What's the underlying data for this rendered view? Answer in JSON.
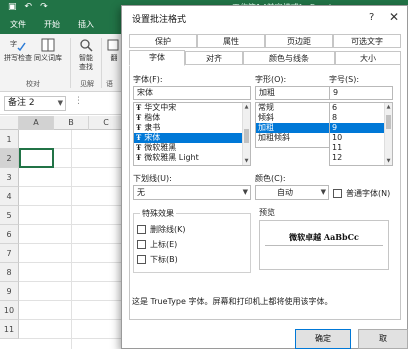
{
  "excel": {
    "window_title": "工作簿1 [兼容模式] - Excel",
    "ribbon_tabs": [
      "文件",
      "开始",
      "插入"
    ],
    "ribbon_buttons": [
      "拼写检查",
      "同义词库",
      "智能查找",
      "翻"
    ],
    "group_labels": [
      "校对",
      "见解",
      "语"
    ],
    "name_box": "备注 2",
    "columns": [
      "A",
      "B",
      "C"
    ],
    "rows": [
      "1",
      "2",
      "3",
      "4",
      "5",
      "6",
      "7",
      "8",
      "9",
      "10",
      "11"
    ],
    "accent_color": "#217346"
  },
  "dialog": {
    "title": "设置批注格式",
    "help": "?",
    "close": "✕",
    "tabs_row1": [
      "保护",
      "属性",
      "页边距",
      "可选文字"
    ],
    "tabs_row2": [
      "字体",
      "对齐",
      "颜色与线条",
      "大小"
    ],
    "active_tab": "字体",
    "font": {
      "label": "字体(F):",
      "value": "宋体",
      "items": [
        "华文中宋",
        "楷体",
        "隶书",
        "宋体",
        "微软雅黑",
        "微软雅黑 Light"
      ],
      "selected": "宋体"
    },
    "style": {
      "label": "字形(O):",
      "value": "加粗",
      "items": [
        "常规",
        "倾斜",
        "加粗",
        "加粗倾斜"
      ],
      "selected": "加粗"
    },
    "size": {
      "label": "字号(S):",
      "value": "9",
      "items": [
        "6",
        "8",
        "9",
        "10",
        "11",
        "12"
      ],
      "selected": "9"
    },
    "underline": {
      "label": "下划线(U):",
      "value": "无"
    },
    "color": {
      "label": "颜色(C):",
      "value": "自动"
    },
    "normal_font": "普通字体(N)",
    "effects": {
      "title": "特殊效果",
      "items": [
        "删除线(K)",
        "上标(E)",
        "下标(B)"
      ]
    },
    "preview": {
      "title": "预览",
      "sample": "微软卓越  AaBbCc"
    },
    "info": "这是 TrueType 字体。屏幕和打印机上都将使用该字体。",
    "ok_label": "确定",
    "cancel_label": "取"
  }
}
